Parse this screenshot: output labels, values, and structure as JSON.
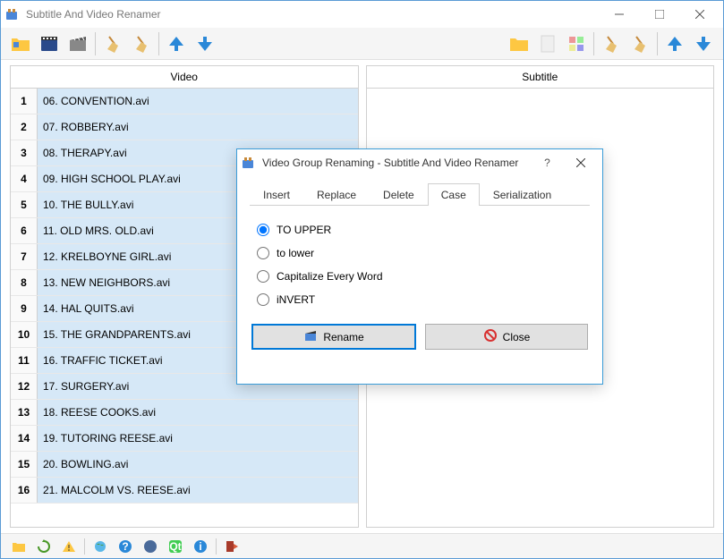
{
  "window_title": "Subtitle And Video Renamer",
  "panels": {
    "video_header": "Video",
    "subtitle_header": "Subtitle"
  },
  "video_list": [
    "06. CONVENTION.avi",
    "07. ROBBERY.avi",
    "08. THERAPY.avi",
    "09. HIGH SCHOOL PLAY.avi",
    "10. THE BULLY.avi",
    "11. OLD MRS. OLD.avi",
    "12. KRELBOYNE GIRL.avi",
    "13. NEW NEIGHBORS.avi",
    "14. HAL QUITS.avi",
    "15. THE GRANDPARENTS.avi",
    "16. TRAFFIC TICKET.avi",
    "17. SURGERY.avi",
    "18. REESE COOKS.avi",
    "19. TUTORING REESE.avi",
    "20. BOWLING.avi",
    "21. MALCOLM VS. REESE.avi"
  ],
  "dialog": {
    "title": "Video Group Renaming - Subtitle And Video Renamer",
    "tabs": {
      "insert": "Insert",
      "replace": "Replace",
      "delete": "Delete",
      "case": "Case",
      "serialization": "Serialization"
    },
    "case_options": {
      "upper": "TO UPPER",
      "lower": "to lower",
      "cap": "Capitalize Every Word",
      "invert": "iNVERT"
    },
    "rename": "Rename",
    "close": "Close"
  }
}
